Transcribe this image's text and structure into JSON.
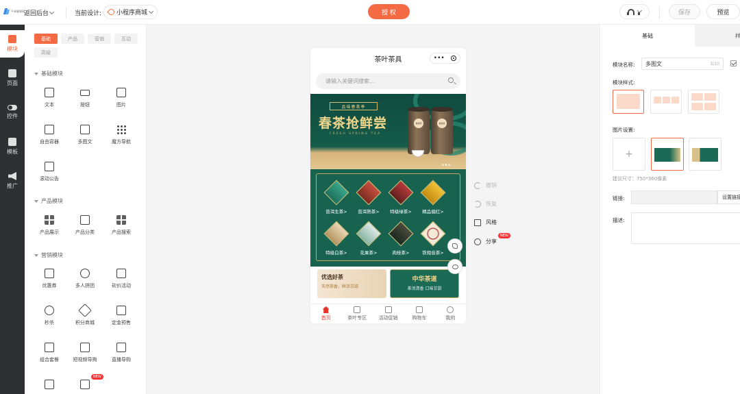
{
  "topbar": {
    "logo_text": "千米星球网",
    "back_label": "返回后台",
    "current_design_label": "当前设计:",
    "design_name": "小程序商城",
    "authorize_label": "授 权",
    "save_label": "保存",
    "preview_label": "预览"
  },
  "rail": [
    {
      "label": "模块",
      "icon": "module-icon",
      "active": true
    },
    {
      "label": "页面",
      "icon": "page-icon",
      "active": false
    },
    {
      "label": "控件",
      "icon": "toggle-icon",
      "active": false
    },
    {
      "label": "模板",
      "icon": "template-icon",
      "active": false
    },
    {
      "label": "推广",
      "icon": "megaphone-icon",
      "active": false
    }
  ],
  "left_panel": {
    "tabs": [
      "基础",
      "产品",
      "营销",
      "互动",
      "高级"
    ],
    "sections": {
      "basic": {
        "title": "基础模块",
        "items": [
          "文本",
          "按钮",
          "图片",
          "自由容器",
          "多图文",
          "魔方导航",
          "滚动公告"
        ]
      },
      "product": {
        "title": "产品模块",
        "items": [
          "产品展示",
          "产品分类",
          "产品搜索"
        ]
      },
      "marketing": {
        "title": "营销模块",
        "items": [
          "优惠券",
          "多人拼团",
          "砍价活动",
          "秒杀",
          "积分商城",
          "定金预售",
          "组合套餐",
          "短视频导购",
          "直播导购"
        ]
      }
    },
    "new_badge": "NEW"
  },
  "phone": {
    "title": "茶叶茶具",
    "capsule_dots": "•••",
    "search_placeholder": "请输入关键词搜索...",
    "banner": {
      "tag": "品味春茶季",
      "title": "春茶抢鲜尝",
      "subtitle": "FRESH SPRING TEA",
      "can_label": "金骏眉"
    },
    "categories": [
      "普洱生茶>",
      "普洱熟茶>",
      "特级绿茶>",
      "精品偏红>",
      "特级白茶>",
      "花果茶>",
      "肉桂茶>",
      "铁观音茶>"
    ],
    "promo_left": {
      "title": "优选好茶",
      "subtitle": "天然茶香，鲜活甘甜"
    },
    "promo_right": {
      "title": "中华茶道",
      "subtitle": "茶汤清香 口味甘甜"
    },
    "tabbar": [
      {
        "label": "首页",
        "active": true
      },
      {
        "label": "茶叶专区",
        "active": false
      },
      {
        "label": "活动促销",
        "active": false
      },
      {
        "label": "购物车",
        "active": false
      },
      {
        "label": "我的",
        "active": false
      }
    ]
  },
  "side_tools": {
    "undo": "撤销",
    "redo": "恢复",
    "style": "风格",
    "share": "分享",
    "share_badge": "NEW"
  },
  "right_panel": {
    "tab_basic": "基础",
    "tab_style": "样",
    "name_label": "模块名称:",
    "name_value": "多图文",
    "name_count": "3/10",
    "style_label": "模块样式:",
    "image_label": "图片设置:",
    "size_hint": "建议尺寸：750*360像素",
    "link_label": "链接:",
    "link_button": "设置链接",
    "desc_label": "描述:"
  },
  "colors": {
    "accent": "#f46a43",
    "rail_bg": "#2f3033",
    "tea_green": "#176350",
    "gold": "#d9bb6a",
    "tab_active": "#e8352a"
  }
}
